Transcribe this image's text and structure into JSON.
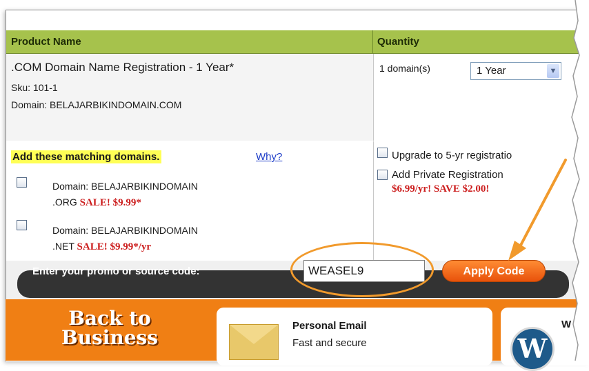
{
  "cart": {
    "header": {
      "product_col": "Product Name",
      "quantity_col": "Quantity"
    },
    "item": {
      "name": ".COM Domain Name Registration - 1 Year*",
      "sku": "Sku: 101-1",
      "domain": "Domain: BELAJARBIKINDOMAIN.COM",
      "quantity_text": "1 domain(s)",
      "term_selected": "1 Year"
    },
    "matching": {
      "title": "Add these matching domains.",
      "why_link": "Why?",
      "domains": [
        {
          "line1": "Domain: BELAJARBIKINDOMAIN",
          "line2_prefix": ".ORG",
          "sale": "SALE! $9.99*"
        },
        {
          "line1": "Domain: BELAJARBIKINDOMAIN",
          "line2_prefix": ".NET",
          "sale": "SALE! $9.99*/yr"
        }
      ]
    },
    "options": {
      "upgrade_label": "Upgrade to 5-yr registratio",
      "private_label": "Add Private Registration",
      "private_price": "$6.99/yr! SAVE $2.00!"
    },
    "promo": {
      "label": "Enter your promo or source code:",
      "value": "WEASEL9",
      "apply_label": "Apply Code"
    },
    "banner": {
      "title_line1": "Back to",
      "title_line2": "Business",
      "email_title": "Personal Email",
      "email_sub": "Fast and secure",
      "second_card_letter": "W"
    }
  },
  "colors": {
    "header_green": "#a6c24c",
    "sale_red": "#cc1e1e",
    "banner_orange": "#f07f14",
    "annotation_orange": "#f19a2c",
    "link_blue": "#1f3ec8"
  }
}
